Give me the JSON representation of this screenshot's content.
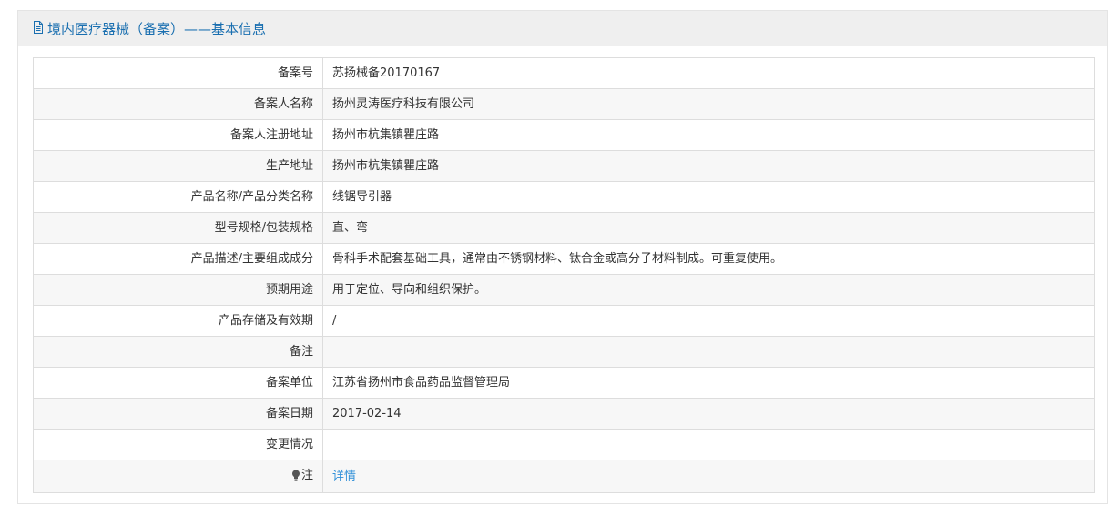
{
  "header": {
    "title": "境内医疗器械（备案）——基本信息",
    "icon": "document-icon"
  },
  "rows": [
    {
      "label": "备案号",
      "value": "苏扬械备20170167"
    },
    {
      "label": "备案人名称",
      "value": "扬州灵涛医疗科技有限公司"
    },
    {
      "label": "备案人注册地址",
      "value": "扬州市杭集镇瞿庄路"
    },
    {
      "label": "生产地址",
      "value": "扬州市杭集镇瞿庄路"
    },
    {
      "label": "产品名称/产品分类名称",
      "value": "线锯导引器"
    },
    {
      "label": "型号规格/包装规格",
      "value": "直、弯"
    },
    {
      "label": "产品描述/主要组成成分",
      "value": "骨科手术配套基础工具，通常由不锈钢材料、钛合金或高分子材料制成。可重复使用。"
    },
    {
      "label": "预期用途",
      "value": "用于定位、导向和组织保护。"
    },
    {
      "label": "产品存储及有效期",
      "value": "/"
    },
    {
      "label": "备注",
      "value": ""
    },
    {
      "label": "备案单位",
      "value": "江苏省扬州市食品药品监督管理局"
    },
    {
      "label": "备案日期",
      "value": "2017-02-14"
    },
    {
      "label": "变更情况",
      "value": ""
    }
  ],
  "note": {
    "label": "注",
    "icon": "lightbulb-icon",
    "link_text": "详情"
  },
  "colors": {
    "header_bg": "#efefef",
    "header_text": "#1a6fb0",
    "link": "#2f8fd8",
    "border": "#dddddd",
    "stripe": "#f7f7f7"
  }
}
